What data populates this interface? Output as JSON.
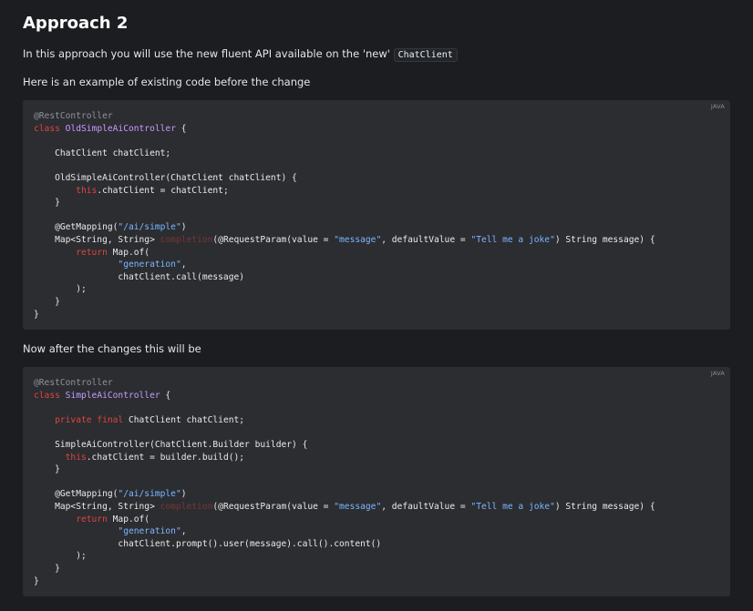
{
  "heading": "Approach 2",
  "intro": {
    "text": "In this approach you will use the new fluent API available on the 'new'",
    "code": "ChatClient"
  },
  "before_label": "Here is an example of existing code before the change",
  "after_label": "Now after the changes this will be",
  "code_blocks": [
    {
      "language": "JAVA",
      "lines": [
        "@RestController",
        "class OldSimpleAiController {",
        "",
        "    ChatClient chatClient;",
        "",
        "    OldSimpleAiController(ChatClient chatClient) {",
        "        this.chatClient = chatClient;",
        "    }",
        "",
        "    @GetMapping(\"/ai/simple\")",
        "    Map<String, String> completion(@RequestParam(value = \"message\", defaultValue = \"Tell me a joke\") String message) {",
        "        return Map.of(",
        "                \"generation\",",
        "                chatClient.call(message)",
        "        );",
        "    }",
        "}"
      ]
    },
    {
      "language": "JAVA",
      "lines": [
        "@RestController",
        "class SimpleAiController {",
        "",
        "    private final ChatClient chatClient;",
        "",
        "    SimpleAiController(ChatClient.Builder builder) {",
        "      this.chatClient = builder.build();",
        "    }",
        "",
        "    @GetMapping(\"/ai/simple\")",
        "    Map<String, String> completion(@RequestParam(value = \"message\", defaultValue = \"Tell me a joke\") String message) {",
        "        return Map.of(",
        "                \"generation\",",
        "                chatClient.prompt().user(message).call().content()",
        "        );",
        "    }",
        "}"
      ]
    }
  ]
}
